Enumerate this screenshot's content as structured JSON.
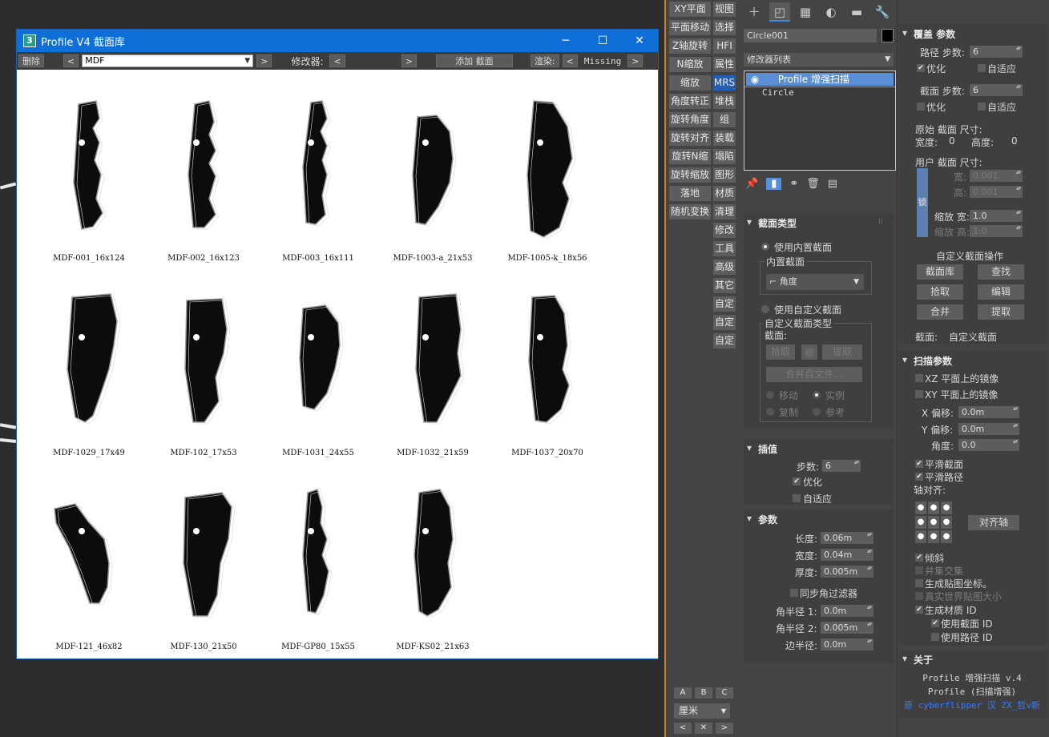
{
  "library": {
    "title": "Profile V4 截面库",
    "app_icon": "3",
    "window_buttons": {
      "minimize": "─",
      "maximize": "☐",
      "close": "✕"
    },
    "toolbar": {
      "delete": "删除",
      "prev": "<",
      "next": ">",
      "combo_value": "MDF",
      "modifier_label": "修改器:",
      "add_section": "添加 截面",
      "render_label": "渲染:",
      "missing": "Missing"
    },
    "items": [
      {
        "label": "MDF-001_16x124"
      },
      {
        "label": "MDF-002_16x123"
      },
      {
        "label": "MDF-003_16x111"
      },
      {
        "label": "MDF-1003-a_21x53"
      },
      {
        "label": "MDF-1005-k_18x56"
      },
      {
        "label": "MDF-1029_17x49"
      },
      {
        "label": "MDF-102_17x53"
      },
      {
        "label": "MDF-1031_24x55"
      },
      {
        "label": "MDF-1032_21x59"
      },
      {
        "label": "MDF-1037_20x70"
      },
      {
        "label": "MDF-121_46x82"
      },
      {
        "label": "MDF-130_21x50"
      },
      {
        "label": "MDF-GP80_15x55"
      },
      {
        "label": "MDF-KS02_21x63"
      }
    ]
  },
  "midbar": {
    "left": [
      "XY平面",
      "平面移动",
      "Z轴旋转",
      "N缩放",
      "缩放",
      "角度转正",
      "旋转角度",
      "旋转对齐",
      "旋转N缩",
      "旋转缩放",
      "落地",
      "随机变换"
    ],
    "right": [
      "视图",
      "选择",
      "HFI",
      "属性",
      "MRS",
      "堆栈",
      "组",
      "装载",
      "塌陷",
      "图形",
      "材质",
      "清理",
      "修改",
      "工具",
      "高级",
      "其它",
      "自定",
      "自定",
      "自定"
    ],
    "abc": [
      "A",
      "B",
      "C"
    ],
    "unit": "厘米",
    "nav": [
      "<",
      "✕",
      ">"
    ]
  },
  "cmd": {
    "object_name": "Circle001",
    "modifier_list": "修改器列表",
    "stack": [
      "Profile 增强扫描",
      "Circle"
    ],
    "section_type": {
      "header": "截面类型",
      "use_builtin": "使用内置截面",
      "builtin_group": "内置截面",
      "builtin_value": "角度",
      "use_custom": "使用自定义截面",
      "custom_group": "自定义截面类型",
      "section_label": "截面:",
      "pick": "拾取",
      "extract": "提取",
      "merge_file": "合并自文件...",
      "move": "移动",
      "instance": "实例",
      "copy": "复制",
      "reference": "参考"
    },
    "interp": {
      "header": "插值",
      "steps_label": "步数:",
      "steps": "6",
      "optimize": "优化",
      "adaptive": "自适应"
    },
    "params": {
      "header": "参数",
      "length_label": "长度:",
      "length": "0.06m",
      "width_label": "宽度:",
      "width": "0.04m",
      "thickness_label": "厚度:",
      "thickness": "0.005m",
      "sync_filter": "同步角过滤器",
      "r1_label": "角半径 1:",
      "r1": "0.0m",
      "r2_label": "角半径 2:",
      "r2": "0.005m",
      "edge_label": "边半径:",
      "edge": "0.0m"
    }
  },
  "right": {
    "override": {
      "header": "覆盖 参数",
      "path_steps_label": "路径 步数:",
      "path_steps": "6",
      "optimize": "优化",
      "adaptive": "自适应",
      "sect_steps_label": "截面 步数:",
      "sect_steps": "6",
      "orig_size": "原始 截面 尺寸:",
      "width_label": "宽度:",
      "width": "0",
      "height_label": "高度:",
      "height": "0",
      "user_size": "用户 截面 尺寸:",
      "lock": "锁",
      "w_label": "宽:",
      "w": "0.001",
      "h_label": "高:",
      "h": "0.001",
      "scale_w_label": "缩放 宽:",
      "scale_w": "1.0",
      "scale_h_label": "缩放 高:",
      "scale_h": "1.0",
      "custom_ops": "自定义截面操作",
      "lib": "截面库",
      "find": "查找",
      "pick": "拾取",
      "edit": "编辑",
      "merge": "合并",
      "extract": "提取",
      "section_label": "截面:",
      "section_value": "自定义截面"
    },
    "sweep": {
      "header": "扫描参数",
      "mirror_xz": "XZ 平面上的镜像",
      "mirror_xy": "XY 平面上的镜像",
      "x_label": "X 偏移:",
      "x": "0.0m",
      "y_label": "Y 偏移:",
      "y": "0.0m",
      "angle_label": "角度:",
      "angle": "0.0",
      "smooth_sect": "平滑截面",
      "smooth_path": "平滑路径",
      "axis_align": "轴对齐:",
      "align_axis": "对齐轴",
      "bank": "倾斜",
      "union": "并集交集",
      "gen_map": "生成贴图坐标。",
      "real_world": "真实世界贴图大小",
      "gen_mat": "生成材质 ID",
      "use_sect_id": "使用截面 ID",
      "use_path_id": "使用路径 ID"
    },
    "about": {
      "header": "关于",
      "line1": "Profile 增强扫描 v.4",
      "line2": "Profile (扫描增强)",
      "line3": "原 cyberflipper 汉 ZX_哲v新"
    }
  }
}
